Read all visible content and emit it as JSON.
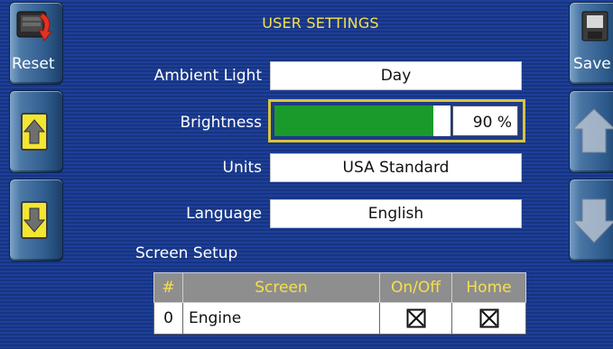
{
  "title": "USER SETTINGS",
  "left_buttons": {
    "reset_label": "Reset",
    "up_icon": "arrow-up-icon",
    "down_icon": "arrow-down-icon"
  },
  "right_buttons": {
    "save_label": "Save",
    "save_icon": "save-icon",
    "up_icon": "arrow-up-icon",
    "down_icon": "arrow-down-icon"
  },
  "settings": {
    "ambient_light": {
      "label": "Ambient Light",
      "value": "Day"
    },
    "brightness": {
      "label": "Brightness",
      "value_text": "90 %",
      "level": 0.9
    },
    "units": {
      "label": "Units",
      "value": "USA Standard"
    },
    "language": {
      "label": "Language",
      "value": "English"
    }
  },
  "screen_setup": {
    "label": "Screen Setup",
    "headers": [
      "#",
      "Screen",
      "On/Off",
      "Home"
    ],
    "rows": [
      {
        "num": "0",
        "screen": "Engine",
        "on_off": true,
        "home": true
      }
    ]
  },
  "colors": {
    "accent_yellow": "#f5e04c",
    "brightness_green": "#1a9a2b",
    "background_blue": "#1d3f9a"
  }
}
